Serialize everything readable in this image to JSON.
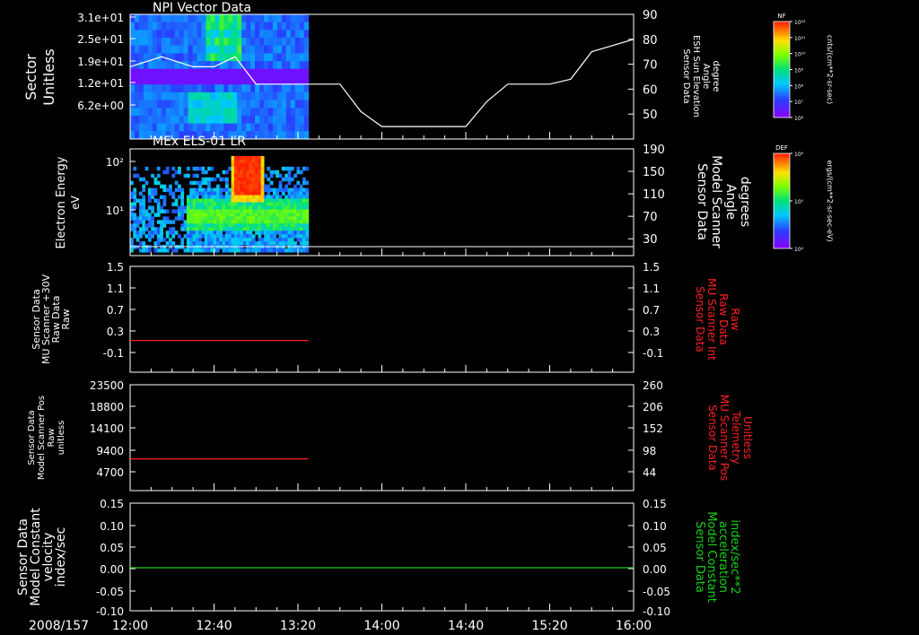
{
  "date_label": "2008/157",
  "time_ticks": [
    "12:00",
    "12:40",
    "13:20",
    "14:00",
    "14:40",
    "15:20",
    "16:00"
  ],
  "colors": {
    "background": "#000000",
    "axis": "#ffffff",
    "red_trace": "#ff2020",
    "green_trace": "#19d119"
  },
  "chart_data": [
    {
      "type": "heatmap",
      "title": "NPI Vector Data",
      "ylabel": [
        "Sector",
        "Unitless"
      ],
      "yticks": [
        "3.1e+01",
        "2.5e+01",
        "1.9e+01",
        "1.2e+01",
        "6.2e+00"
      ],
      "right_ylabel": [
        "Sensor Data",
        "ESH Sun Elevation",
        "Angle",
        "degree"
      ],
      "right_yticks": [
        90,
        80,
        70,
        60,
        50
      ],
      "right_ylim": [
        40,
        90
      ],
      "data_coverage": [
        "12:00",
        "13:25"
      ],
      "overlay_series": {
        "name": "",
        "x": [
          "12:00",
          "12:15",
          "12:30",
          "12:40",
          "12:50",
          "13:00",
          "13:20",
          "13:40",
          "13:50",
          "14:00",
          "14:20",
          "14:40",
          "14:50",
          "15:00",
          "15:20",
          "15:30",
          "15:40",
          "16:00"
        ],
        "y": [
          69,
          73,
          69,
          69,
          73,
          62,
          62,
          62,
          51,
          45,
          45,
          45,
          55,
          62,
          62,
          64,
          75,
          80
        ]
      },
      "colorbar": {
        "label": "NF",
        "units": "cnts/(cm**2-sr-sec)",
        "ticks": [
          "10¹²",
          "10¹¹",
          "10¹⁰",
          "10⁹",
          "10⁸",
          "10⁷",
          "10⁶"
        ]
      }
    },
    {
      "type": "heatmap",
      "title": "MEx ELS-01 LR",
      "ylabel": [
        "Electron Energy",
        "eV"
      ],
      "yticks": [
        "10²",
        "10¹"
      ],
      "right_ylabel": [
        "Sensor Data",
        "Model Scanner",
        "Angle",
        "degrees"
      ],
      "right_yticks": [
        190,
        150,
        110,
        70,
        30
      ],
      "right_ylim": [
        0,
        190
      ],
      "data_coverage": [
        "12:00",
        "13:25"
      ],
      "overlay_series": {
        "name": "",
        "x": [
          "12:00",
          "16:00"
        ],
        "y": [
          0,
          0
        ]
      },
      "colorbar": {
        "label": "DEF",
        "units": "ergs/(cm**2-sr-sec-eV)",
        "ticks": [
          "10⁶",
          "10⁵",
          "10⁴"
        ]
      }
    },
    {
      "type": "line",
      "ylabel": [
        "Sensor Data",
        "MU Scanner +30V",
        "Raw Data",
        "Raw"
      ],
      "yticks": [
        "1.5",
        "1.1",
        "0.7",
        "0.3",
        "-0.1"
      ],
      "ylim": [
        -0.5,
        1.5
      ],
      "right_ylabel": [
        "Sensor Data",
        "MU Scanner Int",
        "Raw Data",
        "Raw"
      ],
      "right_yticks": [
        "1.5",
        "1.1",
        "0.7",
        "0.3",
        "-0.1"
      ],
      "series": [
        {
          "name": "",
          "color": "#ff2020",
          "x": [
            "12:00",
            "13:25"
          ],
          "y": [
            0.1,
            0.1
          ]
        }
      ]
    },
    {
      "type": "line",
      "ylabel": [
        "Sensor Data",
        "Model Scanner Pos",
        "Raw",
        "unitless"
      ],
      "yticks": [
        "23500",
        "18800",
        "14100",
        "9400",
        "4700"
      ],
      "ylim": [
        0,
        23500
      ],
      "right_ylabel": [
        "Sensor Data",
        "MU Scanner Pos",
        "Telemetry",
        "Unitless"
      ],
      "right_yticks": [
        "260",
        "206",
        "152",
        "98",
        "44"
      ],
      "series": [
        {
          "name": "",
          "color": "#ff2020",
          "x": [
            "12:00",
            "13:25"
          ],
          "y": [
            7050,
            7050
          ]
        }
      ]
    },
    {
      "type": "line",
      "ylabel": [
        "Sensor Data",
        "Model Constant",
        "velocity",
        "index/sec"
      ],
      "yticks": [
        "0.15",
        "0.10",
        "0.05",
        "0.00",
        "-0.05",
        "-0.10"
      ],
      "ylim": [
        -0.1,
        0.15
      ],
      "right_ylabel": [
        "Sensor Data",
        "Model Constant",
        "acceleration",
        "index/sec**2"
      ],
      "right_yticks": [
        "0.15",
        "0.10",
        "0.05",
        "0.00",
        "-0.05",
        "-0.10"
      ],
      "series": [
        {
          "name": "",
          "color": "#19d119",
          "x": [
            "12:00",
            "16:00"
          ],
          "y": [
            0.0,
            0.0
          ]
        }
      ]
    }
  ]
}
